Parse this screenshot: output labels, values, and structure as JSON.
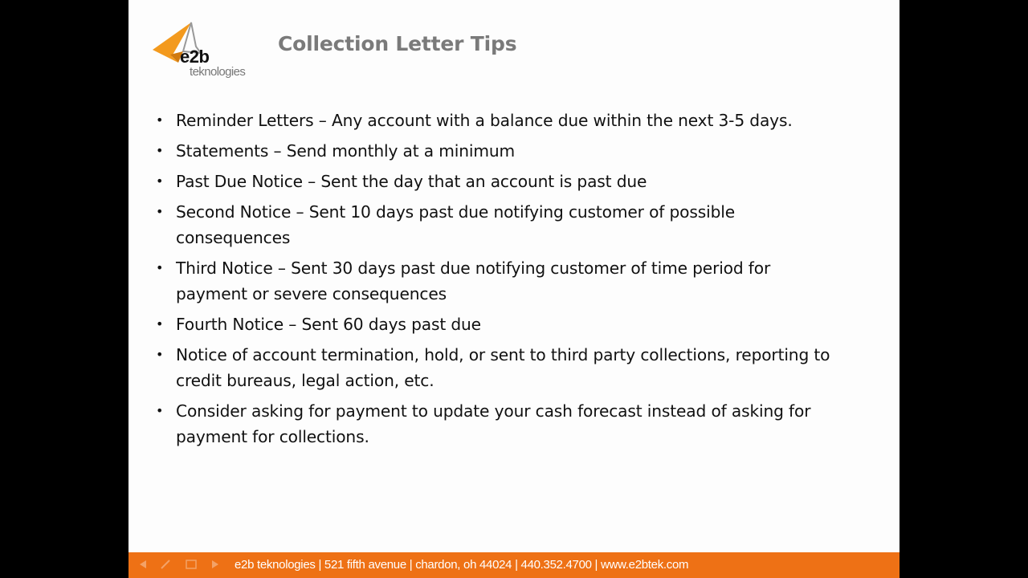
{
  "logo": {
    "brand": "e2b",
    "subtitle": "teknologies",
    "accent": "#f39a1e"
  },
  "title": "Collection Letter Tips",
  "bullets": [
    "Reminder Letters – Any account with a balance due within the next 3-5 days.",
    "Statements – Send monthly at a minimum",
    "Past Due Notice – Sent the day that an account is past due",
    "Second Notice – Sent 10 days past due notifying customer of possible consequences",
    "Third Notice – Sent 30 days past due notifying customer of time period for payment or severe consequences",
    "Fourth Notice – Sent 60 days past due",
    "Notice of account termination,  hold, or sent to third party collections, reporting to credit bureaus, legal action, etc.",
    "Consider asking for payment to update your cash forecast instead of asking for payment for collections."
  ],
  "bullet_glyph": "•",
  "footer": {
    "text": "e2b teknologies | 521 fifth avenue | chardon, oh 44024 | 440.352.4700 | www.e2btek.com",
    "color": "#ee7115",
    "nav_icons": [
      "previous-icon",
      "pen-icon",
      "menu-icon",
      "next-icon"
    ]
  }
}
